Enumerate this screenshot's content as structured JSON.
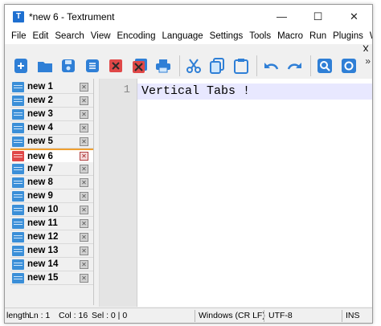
{
  "window": {
    "title": "*new 6 - Textrument",
    "app_icon_letter": "T"
  },
  "window_buttons": {
    "minimize": "—",
    "maximize": "☐",
    "close": "✕"
  },
  "menu": {
    "items": [
      "File",
      "Edit",
      "Search",
      "View",
      "Encoding",
      "Language",
      "Settings",
      "Tools",
      "Macro",
      "Run",
      "Plugins",
      "Window",
      "?"
    ],
    "close_doc": "X"
  },
  "toolbar": {
    "buttons": [
      "new-file",
      "open-file",
      "save",
      "save-all",
      "close",
      "close-all",
      "print",
      "cut",
      "copy",
      "paste",
      "undo",
      "redo",
      "find",
      "replace"
    ],
    "more": "»"
  },
  "tabs": [
    {
      "label": "new 1",
      "active": false
    },
    {
      "label": "new 2",
      "active": false
    },
    {
      "label": "new 3",
      "active": false
    },
    {
      "label": "new 4",
      "active": false
    },
    {
      "label": "new 5",
      "active": false
    },
    {
      "label": "new 6",
      "active": true
    },
    {
      "label": "new 7",
      "active": false
    },
    {
      "label": "new 8",
      "active": false
    },
    {
      "label": "new 9",
      "active": false
    },
    {
      "label": "new 10",
      "active": false
    },
    {
      "label": "new 11",
      "active": false
    },
    {
      "label": "new 12",
      "active": false
    },
    {
      "label": "new 13",
      "active": false
    },
    {
      "label": "new 14",
      "active": false
    },
    {
      "label": "new 15",
      "active": false
    }
  ],
  "tab_close_glyph": "✕",
  "editor": {
    "line_number": "1",
    "text": "Vertical Tabs !"
  },
  "status": {
    "length": "length",
    "ln": "Ln : 1",
    "col": "Col : 16",
    "sel": "Sel : 0 | 0",
    "eol": "Windows (CR LF)",
    "encoding": "UTF-8",
    "mode": "INS"
  },
  "colors": {
    "accent_blue": "#1e6fd0",
    "active_tab_marker": "#f0a030",
    "current_line": "#e8e8ff"
  }
}
